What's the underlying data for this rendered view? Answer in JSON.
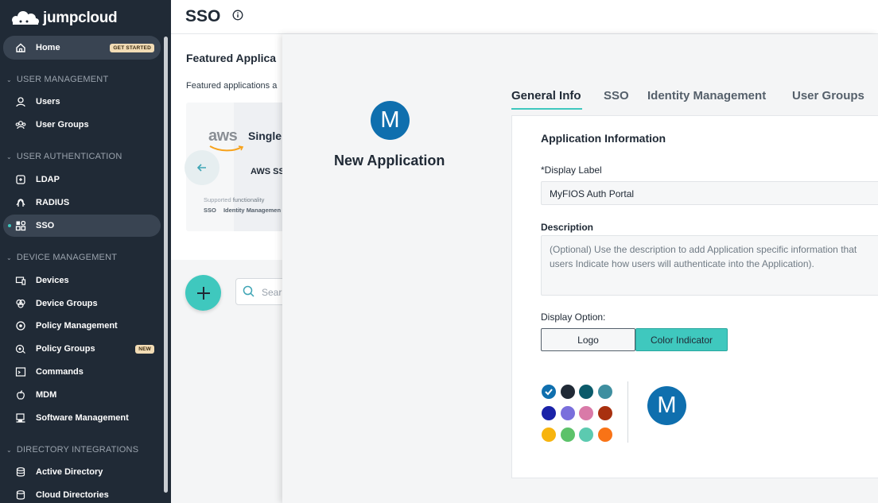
{
  "brand": {
    "name": "jumpcloud"
  },
  "sidebar": {
    "home": {
      "label": "Home",
      "badge": "GET STARTED"
    },
    "sections": [
      {
        "label": "USER MANAGEMENT"
      },
      {
        "label": "USER AUTHENTICATION"
      },
      {
        "label": "DEVICE MANAGEMENT"
      },
      {
        "label": "DIRECTORY INTEGRATIONS"
      }
    ],
    "items": [
      {
        "label": "Users",
        "icon": "user-icon"
      },
      {
        "label": "User Groups",
        "icon": "user-groups-icon"
      },
      {
        "label": "LDAP",
        "icon": "ldap-icon"
      },
      {
        "label": "RADIUS",
        "icon": "radius-icon"
      },
      {
        "label": "SSO",
        "icon": "sso-icon",
        "active": true
      },
      {
        "label": "Devices",
        "icon": "devices-icon"
      },
      {
        "label": "Device Groups",
        "icon": "device-groups-icon"
      },
      {
        "label": "Policy Management",
        "icon": "policy-icon"
      },
      {
        "label": "Policy Groups",
        "icon": "policy-groups-icon",
        "badge": "NEW"
      },
      {
        "label": "Commands",
        "icon": "commands-icon"
      },
      {
        "label": "MDM",
        "icon": "apple-icon"
      },
      {
        "label": "Software Management",
        "icon": "software-icon"
      },
      {
        "label": "Active Directory",
        "icon": "active-directory-icon"
      },
      {
        "label": "Cloud Directories",
        "icon": "cloud-directories-icon"
      }
    ]
  },
  "header": {
    "title": "SSO"
  },
  "background": {
    "featured_title": "Featured Applica",
    "featured_sub": "Featured applications a",
    "tile": {
      "logo_text": "aws",
      "logo_suffix": "Single",
      "name": "AWS SS",
      "supported_prefix": "Supported",
      "supported_suffix": "functionality",
      "features": [
        "SSO",
        "Identity Managemen"
      ]
    },
    "search_placeholder": "Sear"
  },
  "modal": {
    "avatar_letter": "M",
    "app_title": "New Application",
    "tabs": [
      {
        "label": "General Info",
        "active": true
      },
      {
        "label": "SSO"
      },
      {
        "label": "Identity Management"
      },
      {
        "label": "User Groups"
      }
    ],
    "form": {
      "heading": "Application Information",
      "display_label_label": "*Display Label",
      "display_label_value": "MyFIOS Auth Portal",
      "description_label": "Description",
      "description_placeholder": "(Optional) Use the description to add Application specific information that users Indicate how users will authenticate into the Application).",
      "display_option_label": "Display Option:",
      "option_logo": "Logo",
      "option_color": "Color Indicator",
      "selected_option": "Color Indicator"
    },
    "colors": [
      "#0f6fae",
      "#202a36",
      "#0b5a6a",
      "#3f8fa0",
      "#1a22a8",
      "#7a6fdc",
      "#d97aa8",
      "#a8300f",
      "#f7b40e",
      "#5cc26a",
      "#5ccab0",
      "#f97316"
    ],
    "selected_color": "#0f6fae",
    "preview_letter": "M"
  }
}
